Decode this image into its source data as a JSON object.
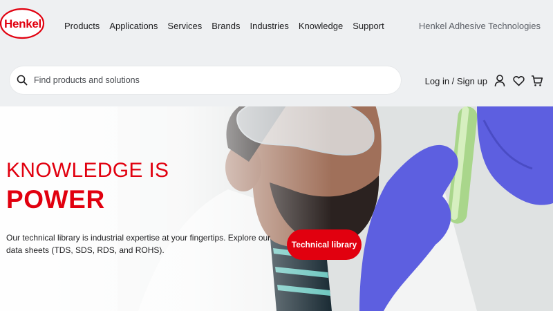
{
  "logo": {
    "text": "Henkel"
  },
  "nav": {
    "items": [
      {
        "label": "Products"
      },
      {
        "label": "Applications"
      },
      {
        "label": "Services"
      },
      {
        "label": "Brands"
      },
      {
        "label": "Industries"
      },
      {
        "label": "Knowledge"
      },
      {
        "label": "Support"
      }
    ],
    "brand_right": "Henkel Adhesive Technologies"
  },
  "search": {
    "placeholder": "Find products and solutions",
    "icon": "search-icon"
  },
  "account": {
    "login_label": "Log in / Sign up",
    "icons": [
      "user-icon",
      "heart-icon",
      "cart-icon"
    ]
  },
  "hero": {
    "headline_line1": "KNOWLEDGE IS",
    "headline_line2": "POWER",
    "text": "Our technical library is industrial expertise at your fingertips. Explore our data sheets (TDS, SDS, RDS, and ROHS).",
    "cta_label": "Technical library"
  },
  "colors": {
    "brand_red": "#e1000f",
    "header_bg": "#eef0f2",
    "glove_blue": "#5d5fe0"
  }
}
